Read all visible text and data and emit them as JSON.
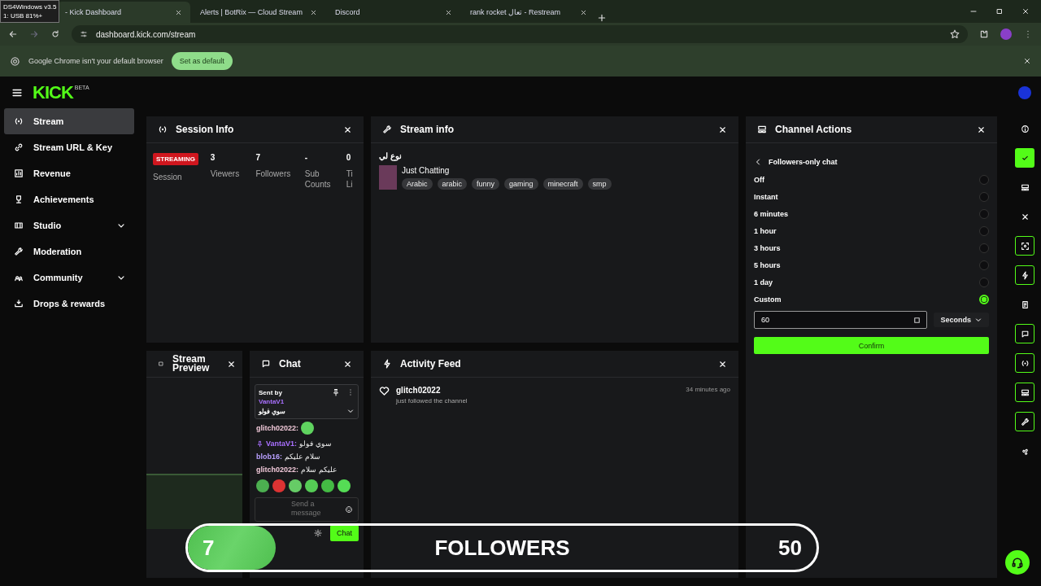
{
  "tooltip": {
    "lines": [
      "DS4Windows v3.5",
      "1: USB 81%+"
    ]
  },
  "browser": {
    "tabs": [
      {
        "title": "- Kick Dashboard",
        "selected": true
      },
      {
        "title": "Alerts | BotRix — Cloud Stream",
        "selected": false
      },
      {
        "title": "Discord",
        "selected": false
      },
      {
        "title": "rank rocket تعال - Restream",
        "selected": false
      }
    ],
    "address": "dashboard.kick.com/stream",
    "infobar": {
      "message": "Google Chrome isn't your default browser",
      "button": "Set as default"
    }
  },
  "header": {
    "logo": "KICK",
    "logo_badge": "BETA"
  },
  "sidebar": {
    "items": [
      {
        "label": "Stream",
        "selected": true,
        "expandable": false
      },
      {
        "label": "Stream URL & Key",
        "selected": false,
        "expandable": false
      },
      {
        "label": "Revenue",
        "selected": false,
        "expandable": false
      },
      {
        "label": "Achievements",
        "selected": false,
        "expandable": false
      },
      {
        "label": "Studio",
        "selected": false,
        "expandable": true
      },
      {
        "label": "Moderation",
        "selected": false,
        "expandable": false
      },
      {
        "label": "Community",
        "selected": false,
        "expandable": true
      },
      {
        "label": "Drops & rewards",
        "selected": false,
        "expandable": false
      }
    ]
  },
  "session_info": {
    "title": "Session Info",
    "status_badge": "STREAMING",
    "status_label": "Session",
    "stats": [
      {
        "value": "3",
        "label": "Viewers"
      },
      {
        "value": "7",
        "label": "Followers"
      },
      {
        "value": "-",
        "label": "Sub Counts"
      },
      {
        "value": "0",
        "label": "Ti Li"
      }
    ]
  },
  "stream_info": {
    "title": "Stream info",
    "stream_title": "نوع لي",
    "category": "Just Chatting",
    "tags": [
      "Arabic",
      "arabic",
      "funny",
      "gaming",
      "minecraft",
      "smp"
    ]
  },
  "stream_preview": {
    "title": "Stream Preview"
  },
  "chat": {
    "title": "Chat",
    "pinned": {
      "header": "Sent by",
      "user": "VantaV1",
      "message": "سوي فولو"
    },
    "messages": [
      {
        "kind": "emote",
        "user": "glitch02022:",
        "color": "#f0c8d8",
        "badge": false
      },
      {
        "kind": "text",
        "user": "VantaV1:",
        "text": "سوي فولو",
        "color": "#a970ff",
        "badge": true
      },
      {
        "kind": "text",
        "user": "blob16:",
        "text": "سلام عليكم",
        "color": "#b9a0ff",
        "badge": false
      },
      {
        "kind": "text",
        "user": "glitch02022:",
        "text": "عليكم سلام",
        "color": "#f0c8d8",
        "badge": false
      }
    ],
    "input_placeholder": "Send a message",
    "send_button": "Chat"
  },
  "activity_feed": {
    "title": "Activity Feed",
    "events": [
      {
        "user": "glitch02022",
        "action": "just followed the channel",
        "time": "34 minutes ago"
      }
    ]
  },
  "channel_actions": {
    "title": "Channel Actions",
    "back_label": "Followers-only chat",
    "options": [
      {
        "label": "Off",
        "selected": false
      },
      {
        "label": "Instant",
        "selected": false
      },
      {
        "label": "6 minutes",
        "selected": false
      },
      {
        "label": "1 hour",
        "selected": false
      },
      {
        "label": "3 hours",
        "selected": false
      },
      {
        "label": "5 hours",
        "selected": false
      },
      {
        "label": "1 day",
        "selected": false
      },
      {
        "label": "Custom",
        "selected": true
      }
    ],
    "custom_value": "60",
    "unit": "Seconds",
    "confirm": "Confirm"
  },
  "goal_overlay": {
    "current": "7",
    "label": "FOLLOWERS",
    "target": "50",
    "level": 0.14
  },
  "right_rail": {
    "items": [
      {
        "kind": "plain"
      },
      {
        "kind": "active"
      },
      {
        "kind": "plain"
      },
      {
        "kind": "plain"
      },
      {
        "kind": "outlined"
      },
      {
        "kind": "outlined"
      },
      {
        "kind": "plain"
      },
      {
        "kind": "outlined"
      },
      {
        "kind": "outlined"
      },
      {
        "kind": "outlined"
      },
      {
        "kind": "outlined"
      },
      {
        "kind": "plain"
      }
    ]
  }
}
